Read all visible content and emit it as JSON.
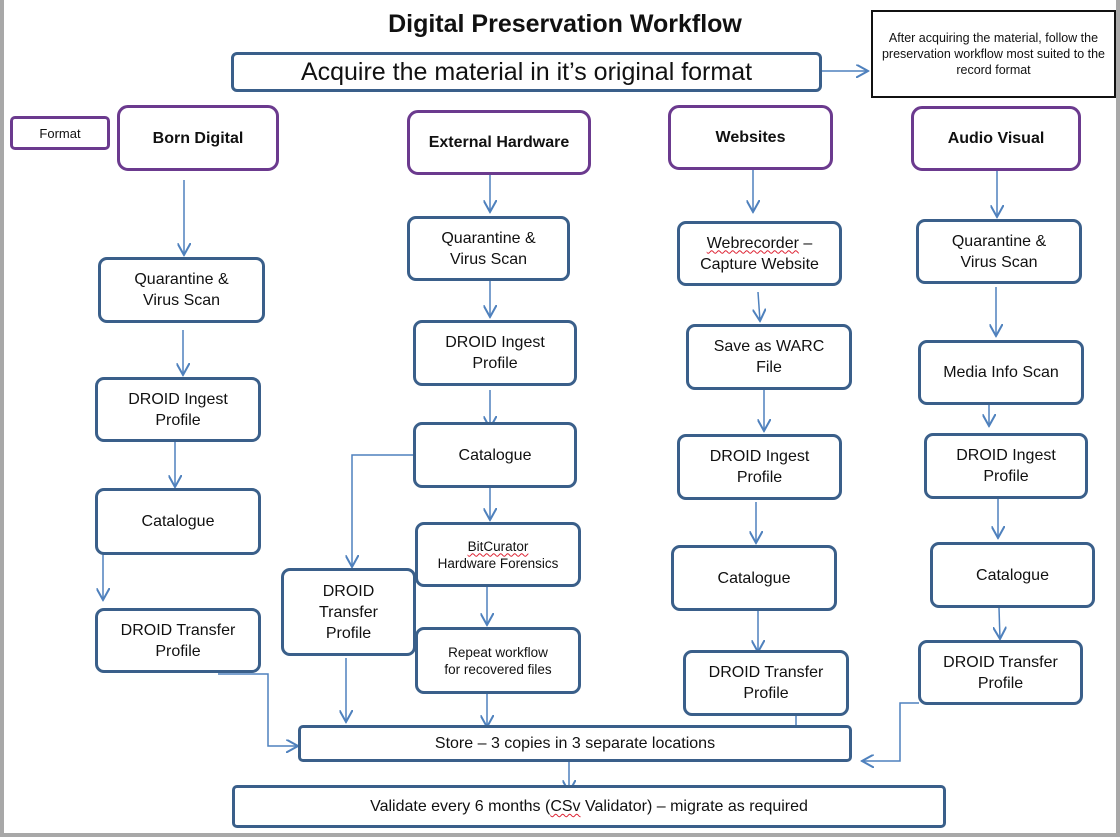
{
  "title": "Digital Preservation Workflow",
  "acquire": "Acquire the material  in it’s original format",
  "note": "After acquiring the material, follow the preservation workflow most suited to the record format",
  "format_label": "Format",
  "colors": {
    "format_border": "#6b3a8e",
    "step_border": "#3a5f8a",
    "arrow": "#4f81bd",
    "frame": "#a8a8a8"
  },
  "columns": [
    {
      "format": "Born Digital",
      "steps": [
        "Quarantine &\nVirus Scan",
        "DROID  Ingest\nProfile",
        "Catalogue",
        "DROID  Transfer\nProfile"
      ]
    },
    {
      "format": "External Hardware",
      "steps": [
        "Quarantine &\nVirus Scan",
        "DROID  Ingest\nProfile",
        "Catalogue",
        "BitCurator\nHardware Forensics",
        "Repeat workflow\nfor recovered files",
        "DROID\nTransfer\nProfile"
      ]
    },
    {
      "format": "Websites",
      "steps": [
        "Webrecorder –\nCapture  Website",
        "Save as WARC\nFile",
        "DROID  Ingest\nProfile",
        "Catalogue",
        "DROID  Transfer\nProfile"
      ]
    },
    {
      "format": "Audio Visual",
      "steps": [
        "Quarantine &\nVirus Scan",
        "Media  Info  Scan",
        "DROID  Ingest\nProfile",
        "Catalogue",
        "DROID  Transfer\nProfile"
      ]
    }
  ],
  "store": "Store – 3 copies in 3 separate locations",
  "validate": "Validate  every 6 months  (CSv  Validator) – migrate  as required"
}
